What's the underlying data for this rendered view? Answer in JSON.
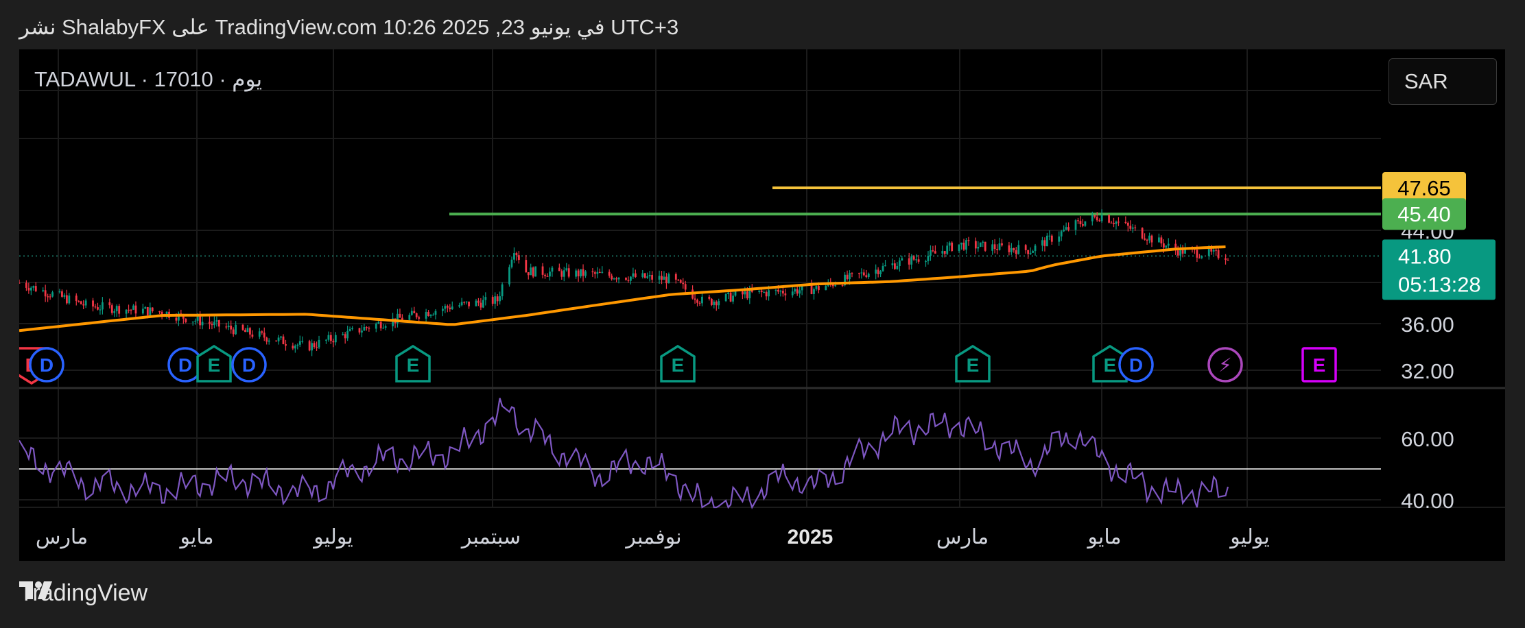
{
  "header": {
    "publish_line": "نشر ShalabyFX على TradingView.com 10:26 2025 ,23 في يونيو UTC+3"
  },
  "chart": {
    "symbol_line": "TADAWUL · 1يوم · 7010",
    "currency": "SAR",
    "price_labels": [
      {
        "text": "47.65",
        "value": 47.65,
        "color": "#f5c33b",
        "text_color": "#000000"
      },
      {
        "text": "45.40",
        "value": 45.4,
        "color": "#4caf50",
        "text_color": "#ffffff"
      },
      {
        "text": "41.80",
        "value": 41.8,
        "color": "#089981",
        "text_color": "#ffffff",
        "sub": "05:13:28"
      }
    ],
    "price_ticks": [
      "44.00",
      "36.00",
      "32.00"
    ],
    "rsi_ticks": [
      "60.00",
      "40.00"
    ],
    "x_ticks": [
      "مارس",
      "مايو",
      "يوليو",
      "سبتمبر",
      "نوفمبر",
      "2025",
      "مارس",
      "مايو",
      "يوليو"
    ],
    "event_markers": [
      "E",
      "D",
      "D",
      "E",
      "D",
      "E",
      "E",
      "E",
      "E",
      "D",
      "E",
      "D",
      "⚡",
      "E"
    ]
  },
  "chart_data": [
    {
      "type": "candlestick",
      "title": "TADAWUL · 1يوم · 7010",
      "ylim": [
        30,
        49
      ],
      "y_ticks": [
        32,
        36,
        44
      ],
      "x_ticks": [
        "مارس",
        "مايو",
        "يوليو",
        "سبتمبر",
        "نوفمبر",
        "2025",
        "مارس",
        "مايو",
        "يوليو"
      ],
      "last_price": 41.8,
      "horizontal_lines": [
        {
          "value": 47.65,
          "color": "#f5c33b"
        },
        {
          "value": 45.4,
          "color": "#4caf50"
        }
      ],
      "price_series": {
        "x": [
          "2024-02",
          "2024-03",
          "2024-04",
          "2024-05",
          "2024-06",
          "2024-07",
          "2024-08",
          "2024-08-20",
          "2024-08-27",
          "2024-09",
          "2024-10",
          "2024-11",
          "2024-11-15",
          "2024-12",
          "2025-01",
          "2025-02",
          "2025-02-20",
          "2025-03",
          "2025-04",
          "2025-04-20",
          "2025-05",
          "2025-05-20",
          "2025-06",
          "2025-06-23"
        ],
        "values": [
          39.5,
          37.5,
          37,
          35.5,
          34,
          36,
          37.5,
          38,
          42.5,
          40.5,
          40.2,
          39.8,
          37.8,
          38.5,
          39,
          41,
          42,
          42.8,
          42.3,
          44.5,
          45.3,
          43.5,
          42.3,
          41.8
        ]
      },
      "moving_average": {
        "x": [
          "2024-02",
          "2024-04",
          "2024-06",
          "2024-08",
          "2024-09",
          "2024-10",
          "2024-11",
          "2024-12",
          "2025-01",
          "2025-02",
          "2025-03",
          "2025-04",
          "2025-04-10",
          "2025-05",
          "2025-06",
          "2025-06-23"
        ],
        "values": [
          35.4,
          36.7,
          36.8,
          35.9,
          36.7,
          37.6,
          38.5,
          38.9,
          39.4,
          39.6,
          40.0,
          40.5,
          41.0,
          41.8,
          42.4,
          42.6
        ],
        "color": "#ff9800"
      }
    },
    {
      "type": "line",
      "name": "RSI",
      "ylim": [
        36,
        70
      ],
      "y_ticks": [
        40,
        60
      ],
      "reference_line": 50,
      "x": [
        "2024-02",
        "2024-03",
        "2024-04",
        "2024-05",
        "2024-06",
        "2024-07",
        "2024-08",
        "2024-08-25",
        "2024-09",
        "2024-10",
        "2024-10-20",
        "2024-11",
        "2024-11-15",
        "2024-12",
        "2024-12-20",
        "2025-01",
        "2025-02",
        "2025-03",
        "2025-04",
        "2025-04-20",
        "2025-05",
        "2025-05-20",
        "2025-06",
        "2025-06-23"
      ],
      "values": [
        55,
        45,
        43,
        47,
        42,
        53,
        55,
        70,
        63,
        48,
        53,
        48,
        38,
        40,
        48,
        44,
        62,
        65,
        52,
        62,
        53,
        44,
        42,
        43
      ],
      "color": "#7e57c2"
    }
  ]
}
